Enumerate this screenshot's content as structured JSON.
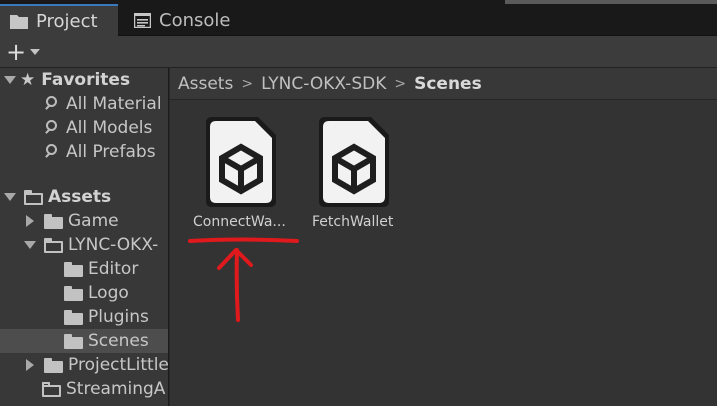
{
  "tabs": [
    {
      "label": "Project",
      "icon": "folder-icon",
      "active": true
    },
    {
      "label": "Console",
      "icon": "console-icon",
      "active": false
    }
  ],
  "toolbar": {
    "add_label": "+"
  },
  "sidebar": {
    "favorites": {
      "label": "Favorites",
      "items": [
        "All Material",
        "All Models",
        "All Prefabs"
      ]
    },
    "assets": {
      "label": "Assets",
      "items": [
        {
          "label": "Game"
        },
        {
          "label": "LYNC-OKX-"
        },
        {
          "label": "Editor"
        },
        {
          "label": "Logo"
        },
        {
          "label": "Plugins"
        },
        {
          "label": "Scenes",
          "selected": true
        },
        {
          "label": "ProjectLittle"
        },
        {
          "label": "StreamingA"
        }
      ]
    }
  },
  "breadcrumb": {
    "items": [
      "Assets",
      "LYNC-OKX-SDK",
      "Scenes"
    ],
    "separator": ">"
  },
  "assets_grid": {
    "items": [
      {
        "label": "ConnectWa...",
        "icon": "unity-scene-icon"
      },
      {
        "label": "FetchWallet",
        "icon": "unity-scene-icon"
      }
    ]
  },
  "colors": {
    "accent": "#3a79bb",
    "annotation": "#e0191c",
    "panel_bg": "#383838",
    "content_bg": "#333333"
  }
}
